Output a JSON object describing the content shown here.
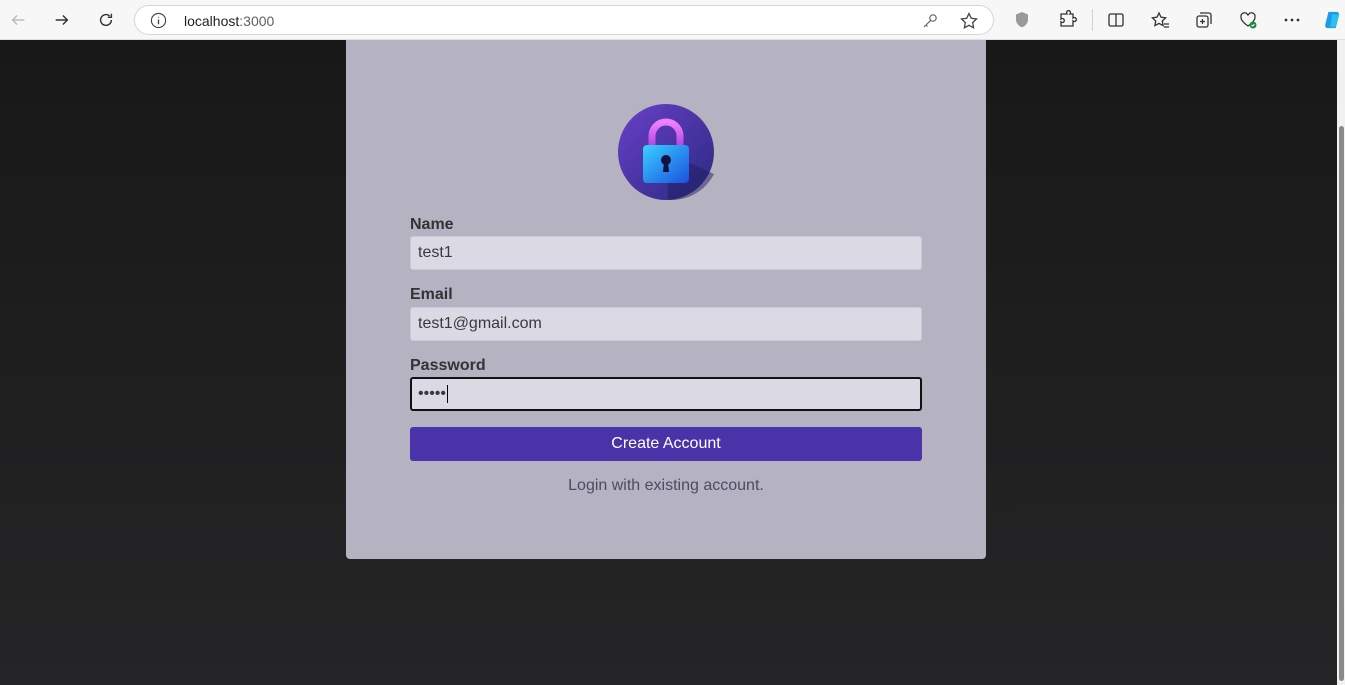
{
  "browser": {
    "url_host": "localhost",
    "url_port": ":3000"
  },
  "form": {
    "name_label": "Name",
    "name_value": "test1",
    "email_label": "Email",
    "email_value": "test1@gmail.com",
    "password_label": "Password",
    "password_value": "•••••",
    "submit_label": "Create Account",
    "login_link": "Login with existing account."
  },
  "colors": {
    "accent": "#4a33a8",
    "card": "#b5b2c2",
    "background": "#1c1c1c"
  },
  "icons": [
    "back-icon",
    "forward-icon",
    "refresh-icon",
    "info-icon",
    "key-icon",
    "star-icon",
    "shield-icon",
    "extensions-icon",
    "split-screen-icon",
    "favorites-icon",
    "collections-icon",
    "health-icon",
    "more-icon",
    "copilot-icon",
    "lock-logo"
  ]
}
